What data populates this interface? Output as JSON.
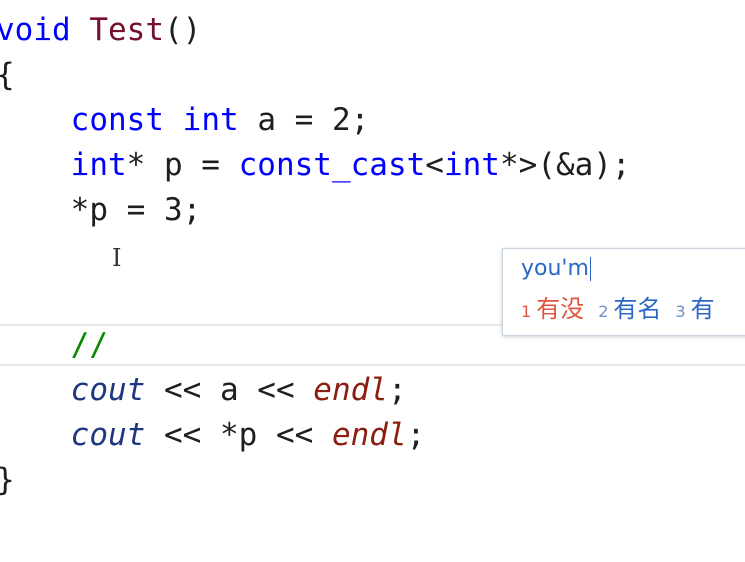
{
  "code": {
    "line1": {
      "keyword": "void",
      "name": "Test",
      "rest": "()"
    },
    "line2": {
      "text": "{"
    },
    "line3": {
      "indent": "    ",
      "kw1": "const",
      "sp1": " ",
      "kw2": "int",
      "rest": " a = 2;"
    },
    "line4": {
      "indent": "    ",
      "kw1": "int",
      "mid": "* p = ",
      "kw2": "const_cast",
      "lt": "<",
      "kw3": "int",
      "rest": "*>(&a);"
    },
    "line5": {
      "indent": "    ",
      "text": "*p = 3;"
    },
    "line7": {
      "indent": "    ",
      "comment": "//"
    },
    "line8": {
      "indent": "    ",
      "cout": "cout",
      "mid": " << a << ",
      "endl": "endl",
      "end": ";"
    },
    "line9": {
      "indent": "    ",
      "cout": "cout",
      "mid": " << *p << ",
      "endl": "endl",
      "end": ";"
    },
    "line10": {
      "text": "}"
    }
  },
  "ime": {
    "input": "you'm",
    "candidates": [
      {
        "num": "1",
        "text": "有没"
      },
      {
        "num": "2",
        "text": "有名"
      },
      {
        "num": "3",
        "text": "有"
      }
    ]
  },
  "colors": {
    "keyword": "#0000ff",
    "function_name": "#74102b",
    "comment": "#0a8a00",
    "cout": "#1f377f",
    "endl": "#8a1f11",
    "ime_input": "#2c66c7",
    "ime_first_candidate": "#e0563e"
  },
  "icons": {
    "cursor": "text-ibeam-cursor-icon"
  }
}
